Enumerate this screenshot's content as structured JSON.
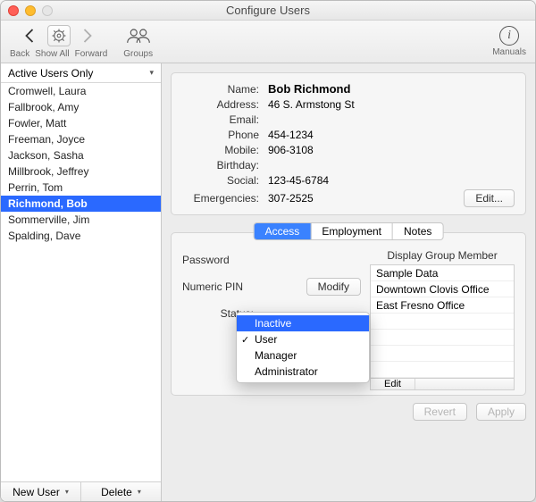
{
  "window": {
    "title": "Configure Users"
  },
  "toolbar": {
    "back": "Back",
    "showall": "Show All",
    "forward": "Forward",
    "groups": "Groups",
    "manuals": "Manuals"
  },
  "sidebar": {
    "filter": "Active Users Only",
    "users": [
      "Cromwell, Laura",
      "Fallbrook, Amy",
      "Fowler, Matt",
      "Freeman, Joyce",
      "Jackson, Sasha",
      "Millbrook, Jeffrey",
      "Perrin, Tom",
      "Richmond, Bob",
      "Sommerville, Jim",
      "Spalding, Dave"
    ],
    "selected_index": 7,
    "new_user": "New User",
    "delete": "Delete"
  },
  "details": {
    "labels": {
      "name": "Name:",
      "address": "Address:",
      "email": "Email:",
      "phone": "Phone",
      "mobile": "Mobile:",
      "birthday": "Birthday:",
      "social": "Social:",
      "emergencies": "Emergencies:"
    },
    "values": {
      "name": "Bob Richmond",
      "address": "46 S. Armstong St",
      "email": "",
      "phone": "454-1234",
      "mobile": "906-3108",
      "birthday": "",
      "social": "123-45-6784",
      "emergencies": "307-2525"
    },
    "edit": "Edit..."
  },
  "tabs": {
    "items": [
      "Access",
      "Employment",
      "Notes"
    ],
    "selected_index": 0
  },
  "access": {
    "password_label": "Password",
    "pin_label": "Numeric PIN",
    "modify": "Modify",
    "status_label": "Status:",
    "status_options": [
      "Inactive",
      "User",
      "Manager",
      "Administrator"
    ],
    "status_highlight_index": 0,
    "status_checked_index": 1,
    "group_title": "Display Group Member",
    "groups": [
      "Sample Data",
      "Downtown Clovis Office",
      "East Fresno Office"
    ],
    "group_edit": "Edit"
  },
  "footer": {
    "revert": "Revert",
    "apply": "Apply"
  }
}
